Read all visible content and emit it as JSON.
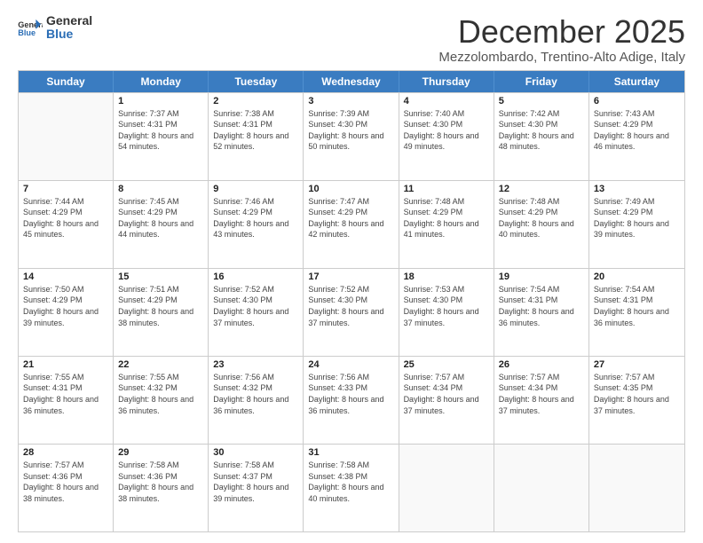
{
  "logo": {
    "general": "General",
    "blue": "Blue"
  },
  "header": {
    "month": "December 2025",
    "subtitle": "Mezzolombardo, Trentino-Alto Adige, Italy"
  },
  "weekdays": [
    "Sunday",
    "Monday",
    "Tuesday",
    "Wednesday",
    "Thursday",
    "Friday",
    "Saturday"
  ],
  "rows": [
    [
      {
        "day": "",
        "empty": true
      },
      {
        "day": "1",
        "sunrise": "Sunrise: 7:37 AM",
        "sunset": "Sunset: 4:31 PM",
        "daylight": "Daylight: 8 hours and 54 minutes."
      },
      {
        "day": "2",
        "sunrise": "Sunrise: 7:38 AM",
        "sunset": "Sunset: 4:31 PM",
        "daylight": "Daylight: 8 hours and 52 minutes."
      },
      {
        "day": "3",
        "sunrise": "Sunrise: 7:39 AM",
        "sunset": "Sunset: 4:30 PM",
        "daylight": "Daylight: 8 hours and 50 minutes."
      },
      {
        "day": "4",
        "sunrise": "Sunrise: 7:40 AM",
        "sunset": "Sunset: 4:30 PM",
        "daylight": "Daylight: 8 hours and 49 minutes."
      },
      {
        "day": "5",
        "sunrise": "Sunrise: 7:42 AM",
        "sunset": "Sunset: 4:30 PM",
        "daylight": "Daylight: 8 hours and 48 minutes."
      },
      {
        "day": "6",
        "sunrise": "Sunrise: 7:43 AM",
        "sunset": "Sunset: 4:29 PM",
        "daylight": "Daylight: 8 hours and 46 minutes."
      }
    ],
    [
      {
        "day": "7",
        "sunrise": "Sunrise: 7:44 AM",
        "sunset": "Sunset: 4:29 PM",
        "daylight": "Daylight: 8 hours and 45 minutes."
      },
      {
        "day": "8",
        "sunrise": "Sunrise: 7:45 AM",
        "sunset": "Sunset: 4:29 PM",
        "daylight": "Daylight: 8 hours and 44 minutes."
      },
      {
        "day": "9",
        "sunrise": "Sunrise: 7:46 AM",
        "sunset": "Sunset: 4:29 PM",
        "daylight": "Daylight: 8 hours and 43 minutes."
      },
      {
        "day": "10",
        "sunrise": "Sunrise: 7:47 AM",
        "sunset": "Sunset: 4:29 PM",
        "daylight": "Daylight: 8 hours and 42 minutes."
      },
      {
        "day": "11",
        "sunrise": "Sunrise: 7:48 AM",
        "sunset": "Sunset: 4:29 PM",
        "daylight": "Daylight: 8 hours and 41 minutes."
      },
      {
        "day": "12",
        "sunrise": "Sunrise: 7:48 AM",
        "sunset": "Sunset: 4:29 PM",
        "daylight": "Daylight: 8 hours and 40 minutes."
      },
      {
        "day": "13",
        "sunrise": "Sunrise: 7:49 AM",
        "sunset": "Sunset: 4:29 PM",
        "daylight": "Daylight: 8 hours and 39 minutes."
      }
    ],
    [
      {
        "day": "14",
        "sunrise": "Sunrise: 7:50 AM",
        "sunset": "Sunset: 4:29 PM",
        "daylight": "Daylight: 8 hours and 39 minutes."
      },
      {
        "day": "15",
        "sunrise": "Sunrise: 7:51 AM",
        "sunset": "Sunset: 4:29 PM",
        "daylight": "Daylight: 8 hours and 38 minutes."
      },
      {
        "day": "16",
        "sunrise": "Sunrise: 7:52 AM",
        "sunset": "Sunset: 4:30 PM",
        "daylight": "Daylight: 8 hours and 37 minutes."
      },
      {
        "day": "17",
        "sunrise": "Sunrise: 7:52 AM",
        "sunset": "Sunset: 4:30 PM",
        "daylight": "Daylight: 8 hours and 37 minutes."
      },
      {
        "day": "18",
        "sunrise": "Sunrise: 7:53 AM",
        "sunset": "Sunset: 4:30 PM",
        "daylight": "Daylight: 8 hours and 37 minutes."
      },
      {
        "day": "19",
        "sunrise": "Sunrise: 7:54 AM",
        "sunset": "Sunset: 4:31 PM",
        "daylight": "Daylight: 8 hours and 36 minutes."
      },
      {
        "day": "20",
        "sunrise": "Sunrise: 7:54 AM",
        "sunset": "Sunset: 4:31 PM",
        "daylight": "Daylight: 8 hours and 36 minutes."
      }
    ],
    [
      {
        "day": "21",
        "sunrise": "Sunrise: 7:55 AM",
        "sunset": "Sunset: 4:31 PM",
        "daylight": "Daylight: 8 hours and 36 minutes."
      },
      {
        "day": "22",
        "sunrise": "Sunrise: 7:55 AM",
        "sunset": "Sunset: 4:32 PM",
        "daylight": "Daylight: 8 hours and 36 minutes."
      },
      {
        "day": "23",
        "sunrise": "Sunrise: 7:56 AM",
        "sunset": "Sunset: 4:32 PM",
        "daylight": "Daylight: 8 hours and 36 minutes."
      },
      {
        "day": "24",
        "sunrise": "Sunrise: 7:56 AM",
        "sunset": "Sunset: 4:33 PM",
        "daylight": "Daylight: 8 hours and 36 minutes."
      },
      {
        "day": "25",
        "sunrise": "Sunrise: 7:57 AM",
        "sunset": "Sunset: 4:34 PM",
        "daylight": "Daylight: 8 hours and 37 minutes."
      },
      {
        "day": "26",
        "sunrise": "Sunrise: 7:57 AM",
        "sunset": "Sunset: 4:34 PM",
        "daylight": "Daylight: 8 hours and 37 minutes."
      },
      {
        "day": "27",
        "sunrise": "Sunrise: 7:57 AM",
        "sunset": "Sunset: 4:35 PM",
        "daylight": "Daylight: 8 hours and 37 minutes."
      }
    ],
    [
      {
        "day": "28",
        "sunrise": "Sunrise: 7:57 AM",
        "sunset": "Sunset: 4:36 PM",
        "daylight": "Daylight: 8 hours and 38 minutes."
      },
      {
        "day": "29",
        "sunrise": "Sunrise: 7:58 AM",
        "sunset": "Sunset: 4:36 PM",
        "daylight": "Daylight: 8 hours and 38 minutes."
      },
      {
        "day": "30",
        "sunrise": "Sunrise: 7:58 AM",
        "sunset": "Sunset: 4:37 PM",
        "daylight": "Daylight: 8 hours and 39 minutes."
      },
      {
        "day": "31",
        "sunrise": "Sunrise: 7:58 AM",
        "sunset": "Sunset: 4:38 PM",
        "daylight": "Daylight: 8 hours and 40 minutes."
      },
      {
        "day": "",
        "empty": true
      },
      {
        "day": "",
        "empty": true
      },
      {
        "day": "",
        "empty": true
      }
    ]
  ]
}
